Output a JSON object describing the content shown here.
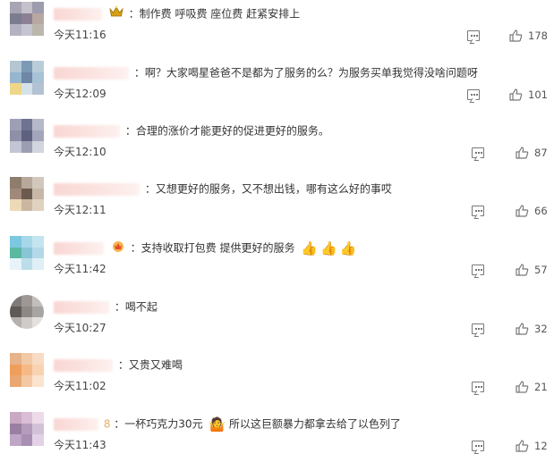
{
  "comments": [
    {
      "text": "：制作费 呼吸费 座位费 赶紧安排上",
      "time": "今天11:16",
      "likes": "178",
      "badge": "crown-icon",
      "avatar": [
        "#a7a4b3",
        "#c4c1cb",
        "#9c9cae",
        "#7c7c8f",
        "#8b8094",
        "#b8a8a3",
        "#b4b2c2",
        "#c5c5d2",
        "#bbb7ac"
      ]
    },
    {
      "text": "：啊？大家喝星爸爸不是都为了服务的么？为服务买单我觉得没啥问题呀",
      "time": "今天12:09",
      "likes": "101",
      "badge": "",
      "avatar": [
        "#b5c6d3",
        "#7a9ab6",
        "#b9cdd8",
        "#96b6cf",
        "#6f86a5",
        "#a7c1d5",
        "#eed788",
        "#d5e2ea",
        "#b3c2d2"
      ]
    },
    {
      "text": "：合理的涨价才能更好的促进更好的服务。",
      "time": "今天12:10",
      "likes": "87",
      "badge": "",
      "avatar": [
        "#9e9fb5",
        "#6e7391",
        "#b5b8c9",
        "#8e90a8",
        "#5e617e",
        "#a2a5bb",
        "#c2c5d3",
        "#9b9eb2",
        "#d2d4de"
      ]
    },
    {
      "text": "：又想更好的服务，又不想出钱，哪有这么好的事哎",
      "time": "今天12:11",
      "likes": "66",
      "badge": "",
      "avatar": [
        "#8f7d6c",
        "#b7a89a",
        "#d1c7bb",
        "#a0897a",
        "#6b5a4e",
        "#c6b7a8",
        "#ecd9b6",
        "#cbb79f",
        "#e0d2c0"
      ]
    },
    {
      "text": "：支持收取打包费 提供更好的服务",
      "time": "今天11:42",
      "likes": "57",
      "badge": "crown-icon",
      "avatar": [
        "#7cc8e0",
        "#a8d7ea",
        "#c4e4ef",
        "#5bb9a1",
        "#88c5d6",
        "#b3d9e8",
        "#e7f3f8",
        "#bcdde9",
        "#dfeff5"
      ]
    },
    {
      "text": "：喝不起",
      "time": "今天10:27",
      "likes": "32",
      "badge": "",
      "avatar": [
        "#7e7a78",
        "#9d9894",
        "#c2bebb",
        "#5f5a57",
        "#8d8884",
        "#a8a4a1",
        "#b5b1ae",
        "#cfcbc8",
        "#e3e0de"
      ]
    },
    {
      "text": "：又贵又难喝",
      "time": "今天11:02",
      "likes": "21",
      "badge": "",
      "avatar": [
        "#e7b38a",
        "#f1c9a6",
        "#f7dcc3",
        "#ef9f5c",
        "#f5b987",
        "#f8d3b2",
        "#e9a873",
        "#f3c8a2",
        "#fbe4cf"
      ]
    },
    {
      "text": "：一杯巧克力30元",
      "text2": "所以这巨额暴力都拿去给了以色列了",
      "time": "今天11:43",
      "likes": "12",
      "badge": "",
      "avatar": [
        "#c9a9c4",
        "#d9bed6",
        "#eedbe9",
        "#9a7fa3",
        "#b59cbc",
        "#d3c1d8",
        "#bda6c6",
        "#a98fb4",
        "#e2d2e6"
      ]
    }
  ],
  "colors": {
    "text": "#333333",
    "time": "#444444",
    "icon": "#777777"
  }
}
